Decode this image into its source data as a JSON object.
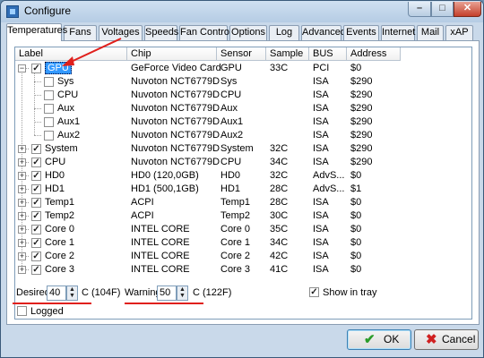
{
  "window": {
    "title": "Configure"
  },
  "titlebar": {
    "min_glyph": "–",
    "max_glyph": "□",
    "close_glyph": "✕"
  },
  "tabs": [
    {
      "label": "Temperatures",
      "active": true
    },
    {
      "label": "Fans"
    },
    {
      "label": "Voltages"
    },
    {
      "label": "Speeds"
    },
    {
      "label": "Fan Control"
    },
    {
      "label": "Options"
    },
    {
      "label": "Log"
    },
    {
      "label": "Advanced"
    },
    {
      "label": "Events"
    },
    {
      "label": "Internet"
    },
    {
      "label": "Mail"
    },
    {
      "label": "xAP"
    }
  ],
  "table": {
    "columns": [
      "Label",
      "Chip",
      "Sensor",
      "Sample",
      "BUS",
      "Address"
    ],
    "rows": [
      {
        "label": "GPU",
        "chip": "GeForce Video Card",
        "sensor": "GPU",
        "sample": "33C",
        "bus": "PCI",
        "address": "$0",
        "level": 0,
        "expander": "−",
        "checked": true,
        "selected": true
      },
      {
        "label": "Sys",
        "chip": "Nuvoton NCT6779D",
        "sensor": "Sys",
        "sample": "",
        "bus": "ISA",
        "address": "$290",
        "level": 1,
        "expander": "",
        "checked": false
      },
      {
        "label": "CPU",
        "chip": "Nuvoton NCT6779D",
        "sensor": "CPU",
        "sample": "",
        "bus": "ISA",
        "address": "$290",
        "level": 1,
        "expander": "",
        "checked": false
      },
      {
        "label": "Aux",
        "chip": "Nuvoton NCT6779D",
        "sensor": "Aux",
        "sample": "",
        "bus": "ISA",
        "address": "$290",
        "level": 1,
        "expander": "",
        "checked": false
      },
      {
        "label": "Aux1",
        "chip": "Nuvoton NCT6779D",
        "sensor": "Aux1",
        "sample": "",
        "bus": "ISA",
        "address": "$290",
        "level": 1,
        "expander": "",
        "checked": false
      },
      {
        "label": "Aux2",
        "chip": "Nuvoton NCT6779D",
        "sensor": "Aux2",
        "sample": "",
        "bus": "ISA",
        "address": "$290",
        "level": 1,
        "expander": "",
        "checked": false
      },
      {
        "label": "System",
        "chip": "Nuvoton NCT6779D",
        "sensor": "System",
        "sample": "32C",
        "bus": "ISA",
        "address": "$290",
        "level": 0,
        "expander": "+",
        "checked": true
      },
      {
        "label": "CPU",
        "chip": "Nuvoton NCT6779D",
        "sensor": "CPU",
        "sample": "34C",
        "bus": "ISA",
        "address": "$290",
        "level": 0,
        "expander": "+",
        "checked": true
      },
      {
        "label": "HD0",
        "chip": "HD0 (120,0GB)",
        "sensor": "HD0",
        "sample": "32C",
        "bus": "AdvS...",
        "address": "$0",
        "level": 0,
        "expander": "+",
        "checked": true
      },
      {
        "label": "HD1",
        "chip": "HD1 (500,1GB)",
        "sensor": "HD1",
        "sample": "28C",
        "bus": "AdvS...",
        "address": "$1",
        "level": 0,
        "expander": "+",
        "checked": true
      },
      {
        "label": "Temp1",
        "chip": "ACPI",
        "sensor": "Temp1",
        "sample": "28C",
        "bus": "ISA",
        "address": "$0",
        "level": 0,
        "expander": "+",
        "checked": true
      },
      {
        "label": "Temp2",
        "chip": "ACPI",
        "sensor": "Temp2",
        "sample": "30C",
        "bus": "ISA",
        "address": "$0",
        "level": 0,
        "expander": "+",
        "checked": true
      },
      {
        "label": "Core 0",
        "chip": "INTEL CORE",
        "sensor": "Core 0",
        "sample": "35C",
        "bus": "ISA",
        "address": "$0",
        "level": 0,
        "expander": "+",
        "checked": true
      },
      {
        "label": "Core 1",
        "chip": "INTEL CORE",
        "sensor": "Core 1",
        "sample": "34C",
        "bus": "ISA",
        "address": "$0",
        "level": 0,
        "expander": "+",
        "checked": true
      },
      {
        "label": "Core 2",
        "chip": "INTEL CORE",
        "sensor": "Core 2",
        "sample": "42C",
        "bus": "ISA",
        "address": "$0",
        "level": 0,
        "expander": "+",
        "checked": true
      },
      {
        "label": "Core 3",
        "chip": "INTEL CORE",
        "sensor": "Core 3",
        "sample": "41C",
        "bus": "ISA",
        "address": "$0",
        "level": 0,
        "expander": "+",
        "checked": true
      }
    ]
  },
  "settings": {
    "desired_label": "Desired",
    "desired_value": "40",
    "desired_unit": "C (104F)",
    "warning_label": "Warning",
    "warning_value": "50",
    "warning_unit": "C (122F)",
    "show_in_tray_label": "Show in tray",
    "show_in_tray_checked": true,
    "logged_label": "Logged",
    "logged_checked": false
  },
  "buttons": {
    "ok": "OK",
    "cancel": "Cancel"
  },
  "colors": {
    "annotation_red": "#e0201c",
    "selection_blue": "#3399ff"
  },
  "icons": {
    "ok": "check-icon",
    "cancel": "x-icon",
    "spin": "spin-arrows-icon"
  }
}
